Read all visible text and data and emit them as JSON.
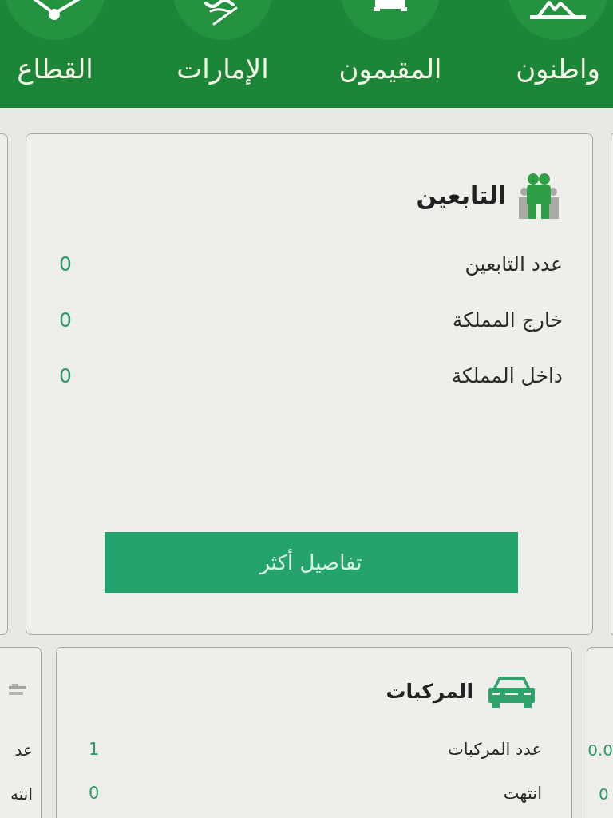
{
  "nav": {
    "items": [
      {
        "label": "واطنون"
      },
      {
        "label": "المقيمون"
      },
      {
        "label": "الإمارات"
      },
      {
        "label": "القطاع"
      }
    ]
  },
  "card_rows": [
    {
      "cards": [
        {
          "kind": "edge"
        },
        {
          "kind": "full",
          "title": "التابعين",
          "rows": [
            {
              "label": "عدد التابعين",
              "value": "0"
            },
            {
              "label": "خارج المملكة",
              "value": "0"
            },
            {
              "label": "داخل المملكة",
              "value": "0"
            }
          ],
          "button": "تفاصيل أكثر"
        },
        {
          "kind": "edge"
        }
      ]
    },
    {
      "cards": [
        {
          "kind": "edge",
          "rows": [
            {
              "value": "0.0"
            },
            {
              "value": "0"
            }
          ]
        },
        {
          "kind": "full",
          "title": "المركبات",
          "rows": [
            {
              "label": "عدد المركبات",
              "value": "1"
            },
            {
              "label": "انتهت",
              "value": "0"
            }
          ]
        },
        {
          "kind": "edge",
          "rows": [
            {
              "label": "عد"
            },
            {
              "label": "انته"
            }
          ]
        }
      ]
    }
  ]
}
